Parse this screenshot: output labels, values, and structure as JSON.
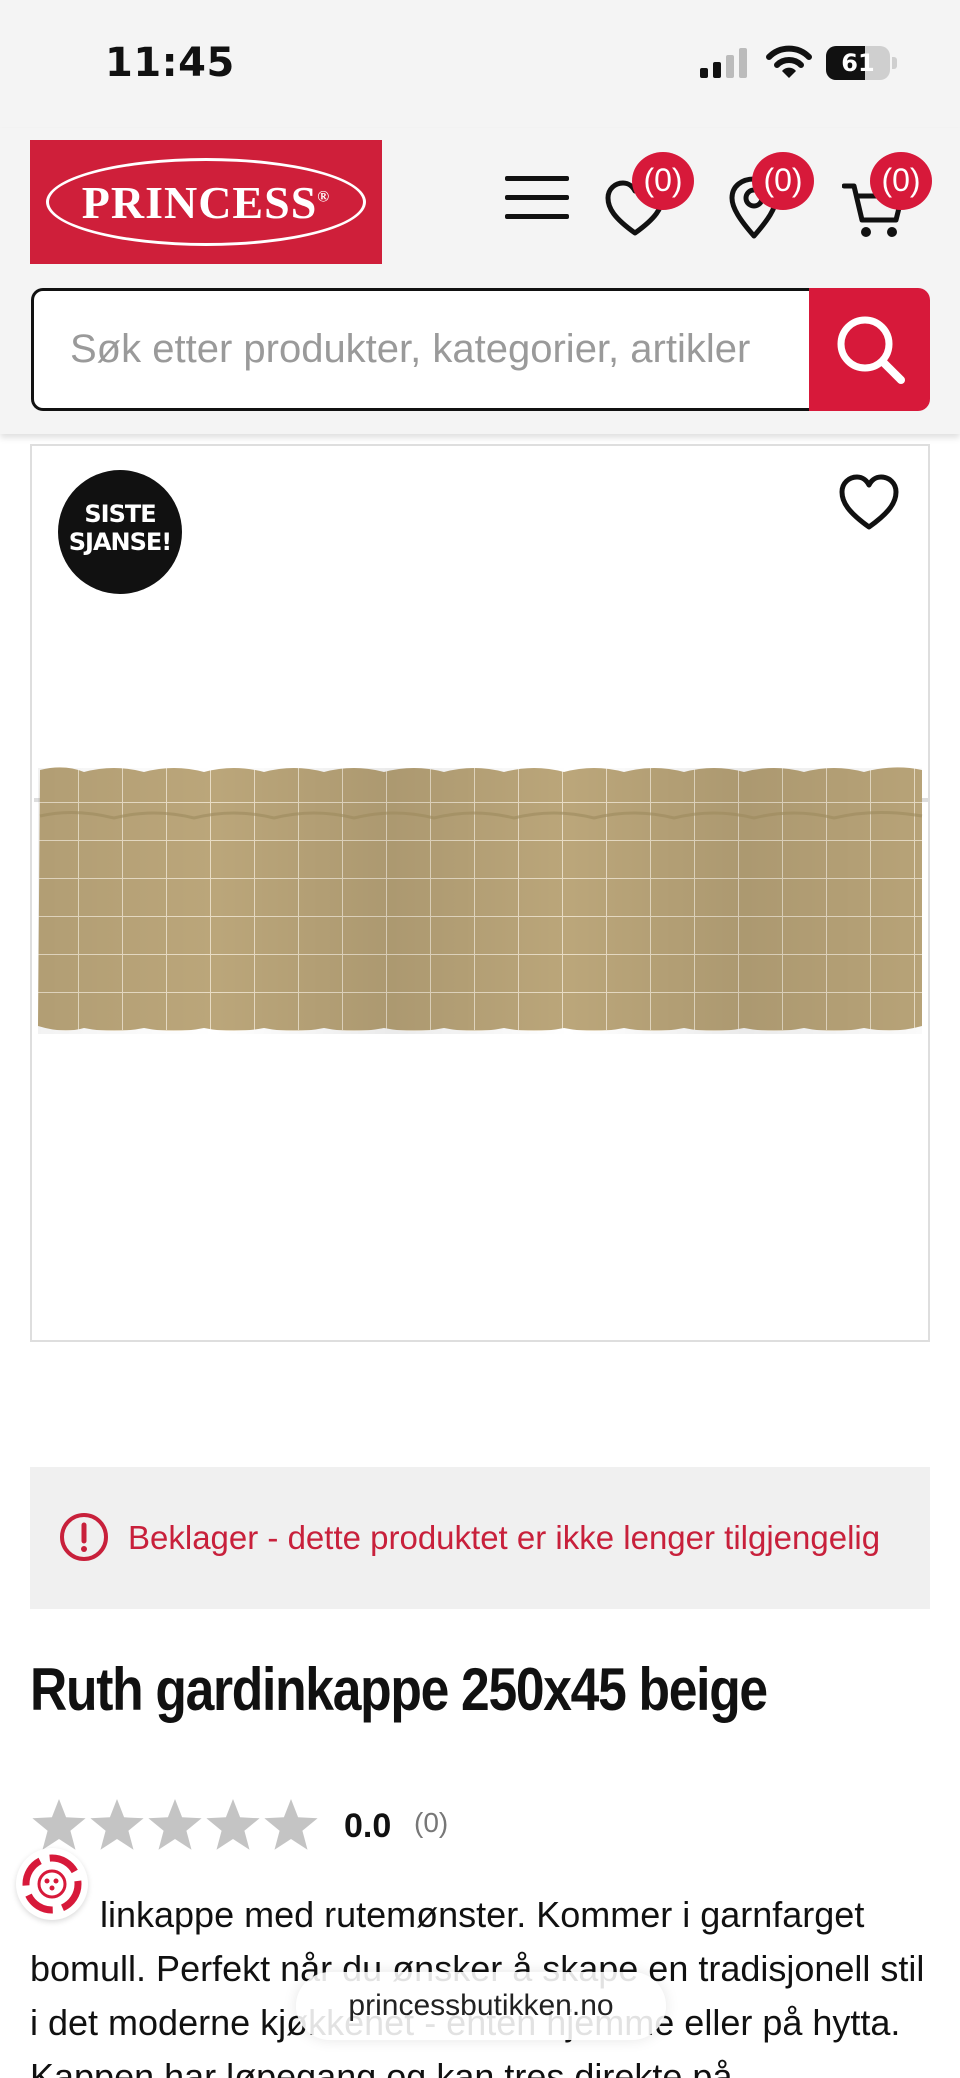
{
  "status_bar": {
    "time": "11:45",
    "battery_level": "61",
    "battery_fraction": 0.61
  },
  "header": {
    "logo_text": "PRINCESS",
    "logo_mark": "®",
    "brand_color": "#cf1f3a",
    "wishlist_count": "(0)",
    "stores_count": "(0)",
    "cart_count": "(0)",
    "icons": [
      "menu-icon",
      "heart-icon",
      "map-pin-icon",
      "cart-icon",
      "search-icon"
    ]
  },
  "search": {
    "placeholder": "Søk etter produkter, kategorier, artikler"
  },
  "product": {
    "badge_line1": "SISTE",
    "badge_line2": "SJANSE!",
    "unavailable_message": "Beklager - dette produktet er ikke lenger tilgjengelig",
    "title": "Ruth gardinkappe 250x45 beige",
    "rating_value": "0.0",
    "rating_count": "(0)",
    "rating_stars": 0,
    "description": "linkappe med rutemønster. Kommer i garnfarget bomull. Perfekt når du ønsker å skape en tradisjonell stil i det moderne kjøkkenet - enten hjemme eller på hytta. Kappen har løpegang og kan tres direkte på"
  },
  "browser": {
    "url": "princessbutikken.no"
  }
}
